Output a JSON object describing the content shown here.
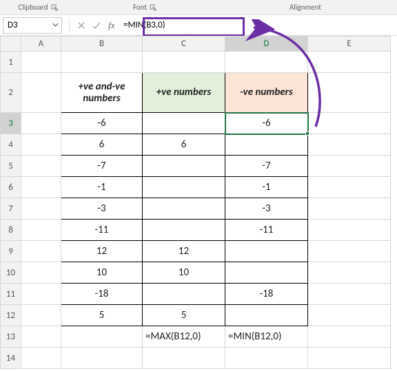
{
  "ribbon": {
    "clipboard_label": "Clipboard",
    "font_label": "Font",
    "alignment_label": "Alignment"
  },
  "namebar": {
    "cellref": "D3",
    "formula": "=MIN(B3,0)",
    "fx_label": "fx"
  },
  "columns": [
    "A",
    "B",
    "C",
    "D",
    "E"
  ],
  "row_numbers": [
    "1",
    "2",
    "3",
    "4",
    "5",
    "6",
    "7",
    "8",
    "9",
    "10",
    "11",
    "12",
    "13",
    "14"
  ],
  "headers": {
    "B": "+ve and-ve numbers",
    "C": "+ve numbers",
    "D": "-ve numbers"
  },
  "chart_data": {
    "type": "table",
    "rows": [
      {
        "B": "-6",
        "C": "",
        "D": "-6"
      },
      {
        "B": "6",
        "C": "6",
        "D": ""
      },
      {
        "B": "-7",
        "C": "",
        "D": "-7"
      },
      {
        "B": "-1",
        "C": "",
        "D": "-1"
      },
      {
        "B": "-3",
        "C": "",
        "D": "-3"
      },
      {
        "B": "-11",
        "C": "",
        "D": "-11"
      },
      {
        "B": "12",
        "C": "12",
        "D": ""
      },
      {
        "B": "10",
        "C": "10",
        "D": ""
      },
      {
        "B": "-18",
        "C": "",
        "D": "-18"
      },
      {
        "B": "5",
        "C": "5",
        "D": ""
      }
    ]
  },
  "formulas_row": {
    "C": "=MAX(B12,0)",
    "D": "=MIN(B12,0)"
  },
  "selection": {
    "col": "D",
    "row": 3
  }
}
